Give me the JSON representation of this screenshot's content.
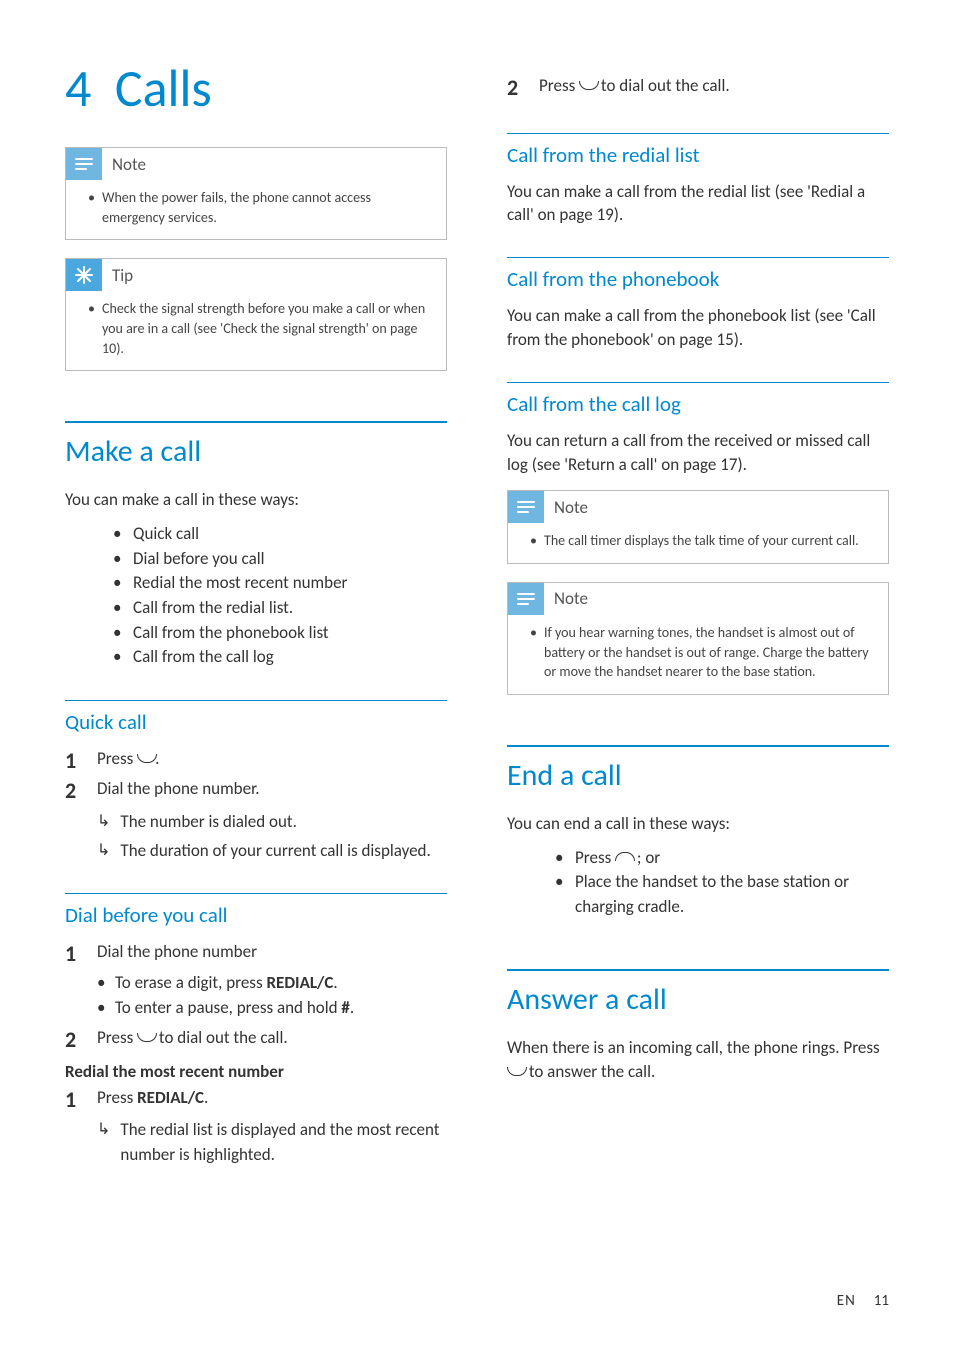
{
  "chapter": {
    "number": "4",
    "title": "Calls"
  },
  "callouts": {
    "note1": {
      "label": "Note",
      "item": "When the power fails, the phone cannot access emergency services."
    },
    "tip1": {
      "label": "Tip",
      "item": "Check the signal strength before you make a call or when you are in a call (see 'Check the signal strength' on page 10)."
    },
    "note2": {
      "label": "Note",
      "item": "The call timer displays the talk time of your current call."
    },
    "note3": {
      "label": "Note",
      "item": "If you hear warning tones, the handset is almost out of battery or the handset is out of range. Charge the battery or move the handset nearer to the base station."
    }
  },
  "left": {
    "make_a_call": {
      "title": "Make a call",
      "intro": "You can make a call in these ways:",
      "bullets": [
        "Quick call",
        "Dial before you call",
        "Redial the most recent number",
        "Call from the redial list.",
        "Call from the phonebook list",
        "Call from the call log"
      ]
    },
    "quick_call": {
      "title": "Quick call",
      "step1_pre": "Press ",
      "step1_post": ".",
      "step2": "Dial the phone number.",
      "sub1": "The number is dialed out.",
      "sub2": "The duration of your current call is displayed."
    },
    "dial_before": {
      "title": "Dial before you call",
      "step1": "Dial the phone number",
      "sb1_pre": "To erase a digit, press ",
      "sb1_key": "REDIAL/C",
      "sb1_post": ".",
      "sb2_pre": "To enter a pause, press and hold ",
      "sb2_key": "#",
      "sb2_post": ".",
      "step2_pre": "Press ",
      "step2_post": " to dial out the call."
    },
    "redial_recent": {
      "title": "Redial the most recent number",
      "step1_pre": "Press ",
      "step1_key": "REDIAL/C",
      "step1_post": ".",
      "sub1": "The redial list is displayed and the most recent number is highlighted."
    }
  },
  "right": {
    "redial_cont": {
      "step2_pre": "Press ",
      "step2_post": " to dial out the call."
    },
    "redial_list": {
      "title": "Call from the redial list",
      "body": "You can make a call from the redial list (see 'Redial a call' on page 19)."
    },
    "phonebook": {
      "title": "Call from the phonebook",
      "body": "You can make a call from the phonebook list (see 'Call from the phonebook' on page 15)."
    },
    "call_log": {
      "title": "Call from the call log",
      "body": "You can return a call from the received or missed call log (see 'Return a call' on page 17)."
    },
    "end_call": {
      "title": "End a call",
      "intro": "You can end a call in these ways:",
      "b1_pre": "Press ",
      "b1_post": " ; or",
      "b2": "Place the handset to the base station or charging cradle."
    },
    "answer": {
      "title": "Answer a call",
      "body_pre": "When there is an incoming call, the phone rings. Press ",
      "body_post": " to answer the call."
    }
  },
  "footer": {
    "lang": "EN",
    "page": "11"
  }
}
